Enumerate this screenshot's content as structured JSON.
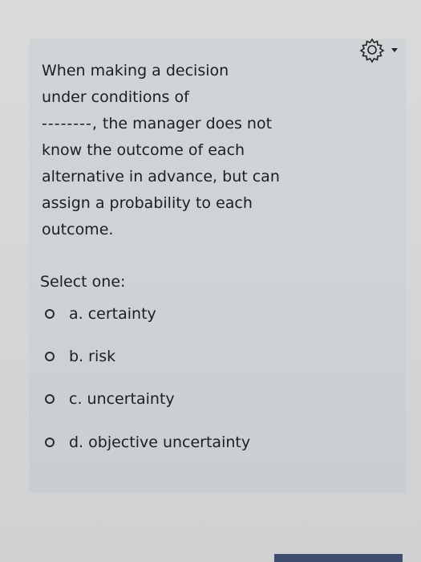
{
  "question": {
    "line1": "When making a decision",
    "line2": "under conditions of",
    "blank": "--------,",
    "line3_rest": " the manager does not",
    "line4": "know the outcome of each",
    "line5": "alternative in advance, but can",
    "line6": "assign a probability to each",
    "line7": "outcome."
  },
  "prompt": "Select one:",
  "options": [
    {
      "label": "a. certainty"
    },
    {
      "label": "b. risk"
    },
    {
      "label": "c. uncertainty"
    },
    {
      "label": "d. objective uncertainty"
    }
  ],
  "icons": {
    "settings": "gear-icon",
    "menu": "caret-down-icon"
  }
}
